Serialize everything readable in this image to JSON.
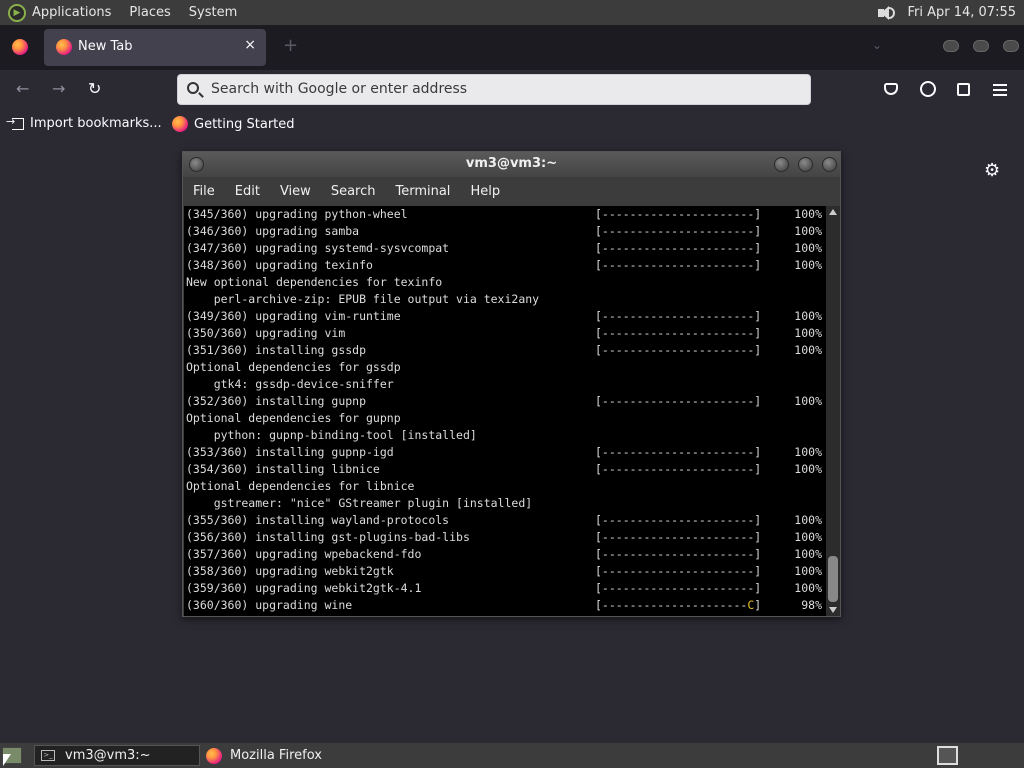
{
  "top_panel": {
    "menus": [
      "Applications",
      "Places",
      "System"
    ],
    "clock": "Fri Apr 14, 07:55",
    "volume_icon": "speaker-volume-icon"
  },
  "firefox": {
    "tab_title": "New Tab",
    "tab_close": "×",
    "new_tab": "+",
    "list_all_tabs": "⌄",
    "nav": {
      "back": "←",
      "forward": "→",
      "reload": "↻"
    },
    "urlbar_placeholder": "Search with Google or enter address",
    "bookmarks": [
      "Import bookmarks...",
      "Getting Started"
    ],
    "settings_icon": "⚙"
  },
  "terminal": {
    "title": "vm3@vm3:~",
    "menu": [
      "File",
      "Edit",
      "View",
      "Search",
      "Terminal",
      "Help"
    ],
    "lines": [
      {
        "text": "(345/360) upgrading python-wheel",
        "bar": "[----------------------]",
        "pct": "100%"
      },
      {
        "text": "(346/360) upgrading samba",
        "bar": "[----------------------]",
        "pct": "100%"
      },
      {
        "text": "(347/360) upgrading systemd-sysvcompat",
        "bar": "[----------------------]",
        "pct": "100%"
      },
      {
        "text": "(348/360) upgrading texinfo",
        "bar": "[----------------------]",
        "pct": "100%"
      },
      {
        "text": "New optional dependencies for texinfo",
        "bar": "",
        "pct": ""
      },
      {
        "text": "    perl-archive-zip: EPUB file output via texi2any",
        "bar": "",
        "pct": ""
      },
      {
        "text": "(349/360) upgrading vim-runtime",
        "bar": "[----------------------]",
        "pct": "100%"
      },
      {
        "text": "(350/360) upgrading vim",
        "bar": "[----------------------]",
        "pct": "100%"
      },
      {
        "text": "(351/360) installing gssdp",
        "bar": "[----------------------]",
        "pct": "100%"
      },
      {
        "text": "Optional dependencies for gssdp",
        "bar": "",
        "pct": ""
      },
      {
        "text": "    gtk4: gssdp-device-sniffer",
        "bar": "",
        "pct": ""
      },
      {
        "text": "(352/360) installing gupnp",
        "bar": "[----------------------]",
        "pct": "100%"
      },
      {
        "text": "Optional dependencies for gupnp",
        "bar": "",
        "pct": ""
      },
      {
        "text": "    python: gupnp-binding-tool [installed]",
        "bar": "",
        "pct": ""
      },
      {
        "text": "(353/360) installing gupnp-igd",
        "bar": "[----------------------]",
        "pct": "100%"
      },
      {
        "text": "(354/360) installing libnice",
        "bar": "[----------------------]",
        "pct": "100%"
      },
      {
        "text": "Optional dependencies for libnice",
        "bar": "",
        "pct": ""
      },
      {
        "text": "    gstreamer: \"nice\" GStreamer plugin [installed]",
        "bar": "",
        "pct": ""
      },
      {
        "text": "(355/360) installing wayland-protocols",
        "bar": "[----------------------]",
        "pct": "100%"
      },
      {
        "text": "(356/360) installing gst-plugins-bad-libs",
        "bar": "[----------------------]",
        "pct": "100%"
      },
      {
        "text": "(357/360) upgrading wpebackend-fdo",
        "bar": "[----------------------]",
        "pct": "100%"
      },
      {
        "text": "(358/360) upgrading webkit2gtk",
        "bar": "[----------------------]",
        "pct": "100%"
      },
      {
        "text": "(359/360) upgrading webkit2gtk-4.1",
        "bar": "[----------------------]",
        "pct": "100%"
      },
      {
        "text": "(360/360) upgrading wine",
        "bar": "[---------------------",
        "bar_cursor": "C",
        "bar_end": "]",
        "pct": "98%"
      }
    ]
  },
  "taskbar": {
    "items": [
      "vm3@vm3:~",
      "Mozilla Firefox"
    ]
  }
}
